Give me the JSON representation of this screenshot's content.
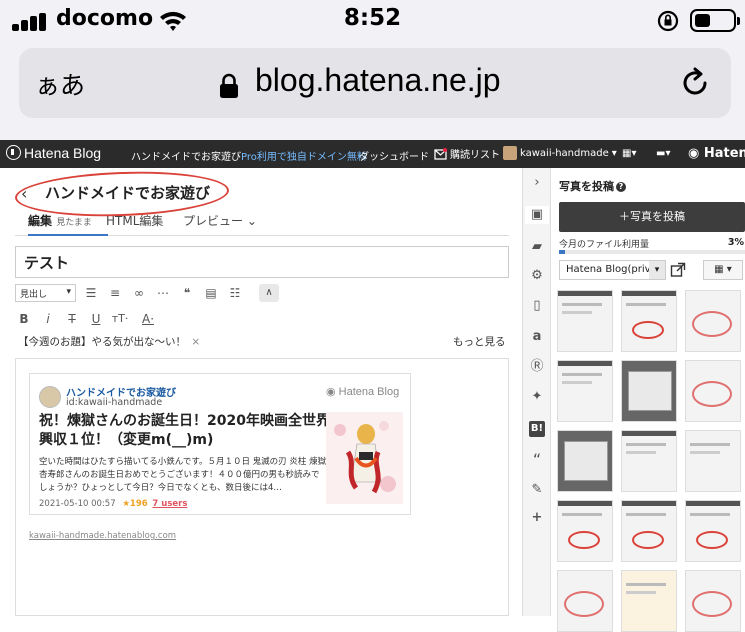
{
  "status_bar": {
    "carrier": "docomo",
    "time": "8:52"
  },
  "browser": {
    "text_size_label": "ぁあ",
    "url": "blog.hatena.ne.jp"
  },
  "hatena_bar": {
    "logo": "Hatena Blog",
    "promo_prefix": "ハンドメイドでお家遊び",
    "promo_link": "Pro利用で独自ドメイン無料",
    "dashboard": "ダッシュボード",
    "reading_list": "購読リスト",
    "user": "kawaii-handmade",
    "hatena": "Hatena"
  },
  "editor": {
    "blog_title": "ハンドメイドでお家遊び",
    "tabs": [
      {
        "label": "編集",
        "sub": "見たまま"
      },
      {
        "label": "HTML編集"
      },
      {
        "label": "プレビュー ⌄"
      }
    ],
    "entry_title": "テスト",
    "toolbar": {
      "heading_select": "見出し"
    },
    "odai": "【今週のお題】やる気が出な〜い！",
    "odai_close": "×",
    "more_link": "もっと見る"
  },
  "embed_card": {
    "blog_name": "ハンドメイドでお家遊び",
    "blog_id": "id:kawaii-handmade",
    "brand": "Hatena Blog",
    "title": "祝！煉獄さんのお誕生日！2020年映画全世界興収１位！（変更m(__)m)",
    "description": "空いた時間はひたすら描いてる小鉄んです。５月１０日 鬼滅の刃 炎柱 煉獄杏寿郎さんのお誕生日おめでとうございます！４００億円の男も秒読みでしょうか？ひょっとして今日？今日でなくとも、数日後には4…",
    "date": "2021-05-10 00:57",
    "stars": "★196",
    "users": "7 users",
    "link_url": "kawaii-handmade.hatenablog.com"
  },
  "photo_panel": {
    "title": "写真を投稿",
    "help": "?",
    "post_button": "＋写真を投稿",
    "usage_label": "今月のファイル利用量",
    "usage_percent": "3%",
    "usage_value": 0.03,
    "album": "Hatena Blog(priva"
  },
  "icons": {
    "rail": [
      "chevron-right",
      "photo",
      "folder",
      "gear",
      "document",
      "amazon",
      "rakuten",
      "twitter",
      "hatena-bookmark",
      "quote",
      "brush",
      "plus"
    ]
  },
  "colors": {
    "annotation": "#d9433a",
    "hatena_bar": "#2b2b2b",
    "accent": "#3a76c4"
  }
}
